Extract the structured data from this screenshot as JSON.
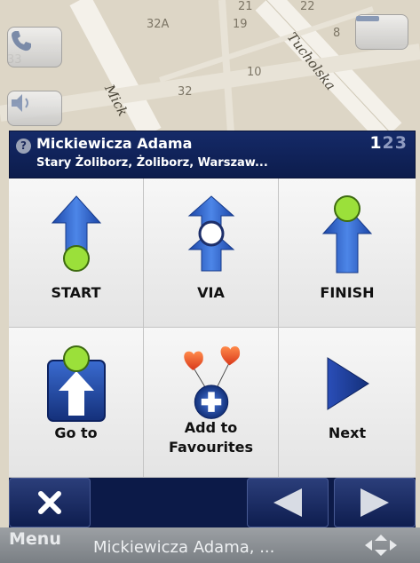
{
  "map": {
    "house_numbers": [
      "32A",
      "19",
      "8",
      "10",
      "32",
      "33",
      "21",
      "22"
    ],
    "streets": [
      "Tucholska",
      "Mick"
    ]
  },
  "header": {
    "title": "Mickiewicza Adama",
    "subtitle": "Stary Żoliborz, Żoliborz, Warszaw...",
    "page_current": "1",
    "page_rest": "23"
  },
  "actions": [
    {
      "label": "START",
      "icon": "start-arrow-icon"
    },
    {
      "label": "VIA",
      "icon": "via-arrow-icon"
    },
    {
      "label": "FINISH",
      "icon": "finish-arrow-icon"
    },
    {
      "label": "Go to",
      "icon": "goto-icon"
    },
    {
      "label": "Add to\nFavourites",
      "icon": "add-favourites-icon"
    },
    {
      "label": "Next",
      "icon": "next-triangle-icon"
    }
  ],
  "softkeys": {
    "left": "Menu",
    "title": "Mickiewicza Adama, ..."
  },
  "colors": {
    "header_bg": "#152a68",
    "arrow_blue": "#2e5fc4",
    "marker_green": "#9be03a",
    "heart_red": "#e8502a"
  }
}
